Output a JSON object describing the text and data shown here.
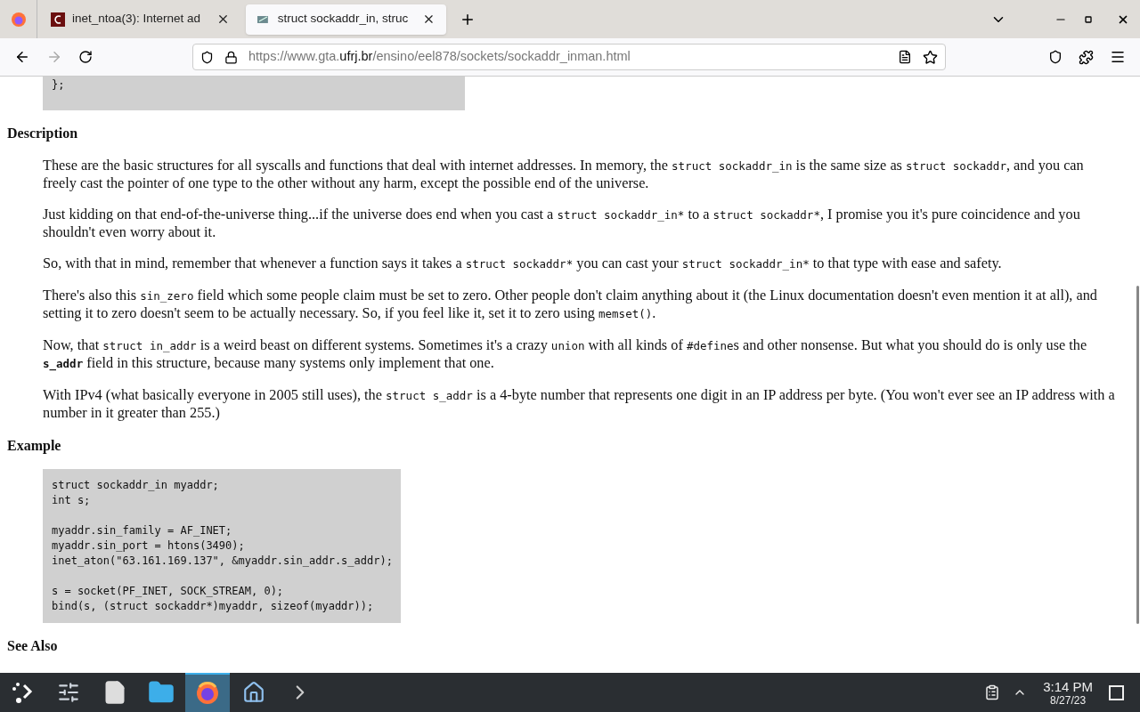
{
  "tabs": [
    {
      "title": "inet_ntoa(3): Internet ad",
      "selected": false,
      "kind": "letter"
    },
    {
      "title": "struct sockaddr_in, struc",
      "selected": true,
      "kind": "image"
    }
  ],
  "url": {
    "scheme": "https://www.gta.",
    "domain": "ufrj.br",
    "path": "/ensino/eel878/sockets/sockaddr_inman.html"
  },
  "top_code": "};",
  "sections": [
    {
      "heading": "Description",
      "paragraphs": [
        [
          {
            "kind": "text",
            "text": "These are the basic structures for all syscalls and functions that deal with internet addresses. In memory, the "
          },
          {
            "kind": "code",
            "text": "struct sockaddr_in"
          },
          {
            "kind": "text",
            "text": " is the same size as "
          },
          {
            "kind": "code",
            "text": "struct sockaddr"
          },
          {
            "kind": "text",
            "text": ", and you can freely cast the pointer of one type to the other without any harm, except the possible end of the universe."
          }
        ],
        [
          {
            "kind": "text",
            "text": "Just kidding on that end-of-the-universe thing...if the universe does end when you cast a "
          },
          {
            "kind": "code",
            "text": "struct sockaddr_in*"
          },
          {
            "kind": "text",
            "text": " to a "
          },
          {
            "kind": "code",
            "text": "struct sockaddr*"
          },
          {
            "kind": "text",
            "text": ", I promise you it's pure coincidence and you shouldn't even worry about it."
          }
        ],
        [
          {
            "kind": "text",
            "text": "So, with that in mind, remember that whenever a function says it takes a "
          },
          {
            "kind": "code",
            "text": "struct sockaddr*"
          },
          {
            "kind": "text",
            "text": " you can cast your "
          },
          {
            "kind": "code",
            "text": "struct sockaddr_in*"
          },
          {
            "kind": "text",
            "text": " to that type with ease and safety."
          }
        ],
        [
          {
            "kind": "text",
            "text": "There's also this "
          },
          {
            "kind": "code",
            "text": "sin_zero"
          },
          {
            "kind": "text",
            "text": " field which some people claim must be set to zero. Other people don't claim anything about it (the Linux documentation doesn't even mention it at all), and setting it to zero doesn't seem to be actually necessary. So, if you feel like it, set it to zero using "
          },
          {
            "kind": "code",
            "text": "memset()"
          },
          {
            "kind": "text",
            "text": "."
          }
        ],
        [
          {
            "kind": "text",
            "text": "Now, that "
          },
          {
            "kind": "code",
            "text": "struct in_addr"
          },
          {
            "kind": "text",
            "text": " is a weird beast on different systems. Sometimes it's a crazy "
          },
          {
            "kind": "code",
            "text": "union"
          },
          {
            "kind": "text",
            "text": " with all kinds of "
          },
          {
            "kind": "code",
            "text": "#define"
          },
          {
            "kind": "text",
            "text": "s and other nonsense. But what you should do is only use the "
          },
          {
            "kind": "code_bold",
            "text": "s_addr"
          },
          {
            "kind": "text",
            "text": " field in this structure, because many systems only implement that one."
          }
        ],
        [
          {
            "kind": "text",
            "text": "With IPv4 (what basically everyone in 2005 still uses), the "
          },
          {
            "kind": "code",
            "text": "struct s_addr"
          },
          {
            "kind": "text",
            "text": " is a 4-byte number that represents one digit in an IP address per byte. (You won't ever see an IP address with a number in it greater than 255.)"
          }
        ]
      ]
    },
    {
      "heading": "Example",
      "code": "struct sockaddr_in myaddr;\nint s;\n\nmyaddr.sin_family = AF_INET;\nmyaddr.sin_port = htons(3490);\ninet_aton(\"63.161.169.137\", &myaddr.sin_addr.s_addr);\n\ns = socket(PF_INET, SOCK_STREAM, 0);\nbind(s, (struct sockaddr*)myaddr, sizeof(myaddr));"
    },
    {
      "heading": "See Also"
    }
  ],
  "taskbar": {
    "apps": [
      {
        "kind": "launcher",
        "selected": false
      },
      {
        "kind": "settings",
        "selected": false
      },
      {
        "kind": "document",
        "selected": false
      },
      {
        "kind": "folder",
        "selected": false
      },
      {
        "kind": "browser",
        "selected": true
      },
      {
        "kind": "home",
        "selected": false
      },
      {
        "kind": "terminal",
        "selected": false
      }
    ],
    "time": "3:14 PM",
    "date": "8/27/23"
  }
}
